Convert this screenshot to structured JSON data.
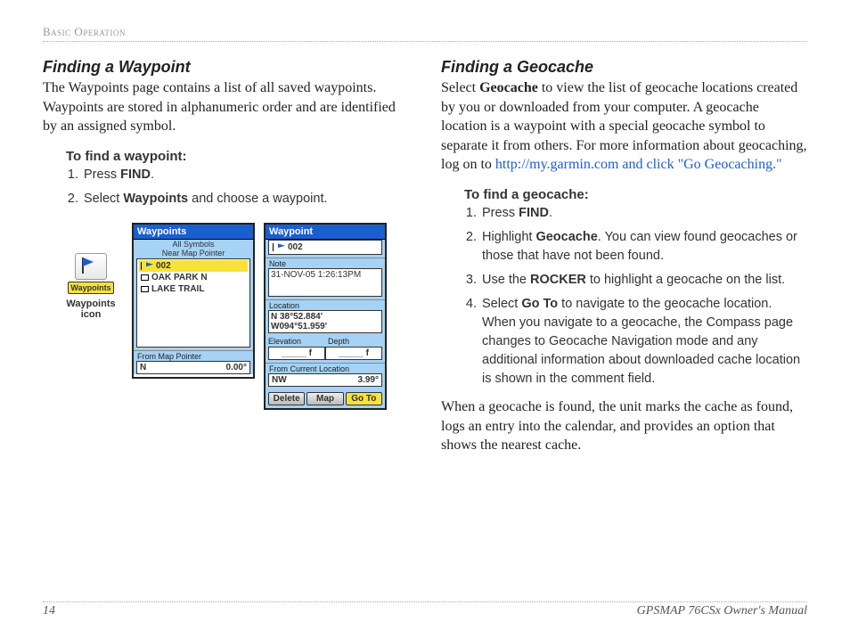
{
  "header": "Basic Operation",
  "left": {
    "title": "Finding a Waypoint",
    "para1": "The Waypoints page contains a list of all saved waypoints. Waypoints are stored in alphanumeric order and are identified by an assigned symbol.",
    "sub_title": "To find a waypoint:",
    "steps": [
      {
        "pre": "Press ",
        "bold": "FIND",
        "post": "."
      },
      {
        "pre": "Select ",
        "bold": "Waypoints",
        "post": " and choose a waypoint."
      }
    ],
    "icon_caption_l1": "Waypoints",
    "icon_caption_l2": "icon",
    "icon_button_label": "Waypoints"
  },
  "right": {
    "title": "Finding a Geocache",
    "para1_pre": "Select ",
    "para1_bold": "Geocache",
    "para1_post": " to view the list of geocache locations created by you or downloaded from your computer. A geocache location is a waypoint with a special geocache symbol to separate it from others. For more information about geocaching, log on to ",
    "link": "http://my.garmin.com and click \"Go Geocaching.\"",
    "sub_title": "To find a geocache:",
    "steps": [
      {
        "pre": "Press ",
        "bold": "FIND",
        "post": "."
      },
      {
        "pre": "Highlight ",
        "bold": "Geocache",
        "post": ". You can view found geocaches or those that have not been found."
      },
      {
        "pre": "Use the ",
        "bold": "ROCKER",
        "post": " to highlight a geocache on the list."
      },
      {
        "pre": "Select ",
        "bold": "Go To",
        "post": " to navigate to the geocache location. When you navigate to a geocache, the Compass page changes to Geocache Navigation mode and any additional information about downloaded cache location is shown in the comment field."
      }
    ],
    "para2": "When a geocache is found, the unit marks the cache as found, logs an entry into the calendar, and provides an option that shows the nearest cache."
  },
  "screens": {
    "left": {
      "title": "Waypoints",
      "context1": "All Symbols",
      "context2": "Near Map Pointer",
      "rows": [
        "002",
        "OAK PARK N",
        "LAKE TRAIL"
      ],
      "from_label": "From Map Pointer",
      "from_dir": "N",
      "from_dist": "0.00°"
    },
    "right": {
      "title": "Waypoint",
      "name": "002",
      "note_label": "Note",
      "note_value": "31-NOV-05 1:26:13PM",
      "location_label": "Location",
      "lat": "N  38°52.884'",
      "lon": "W094°51.959'",
      "elev_label": "Elevation",
      "depth_label": "Depth",
      "elev_val": "_____ f",
      "depth_val": "_____ f",
      "from_label": "From Current Location",
      "from_dir": "NW",
      "from_dist": "3.99°",
      "btn_delete": "Delete",
      "btn_map": "Map",
      "btn_goto": "Go To"
    }
  },
  "footer": {
    "page": "14",
    "manual": "GPSMAP 76CSx Owner's Manual"
  }
}
